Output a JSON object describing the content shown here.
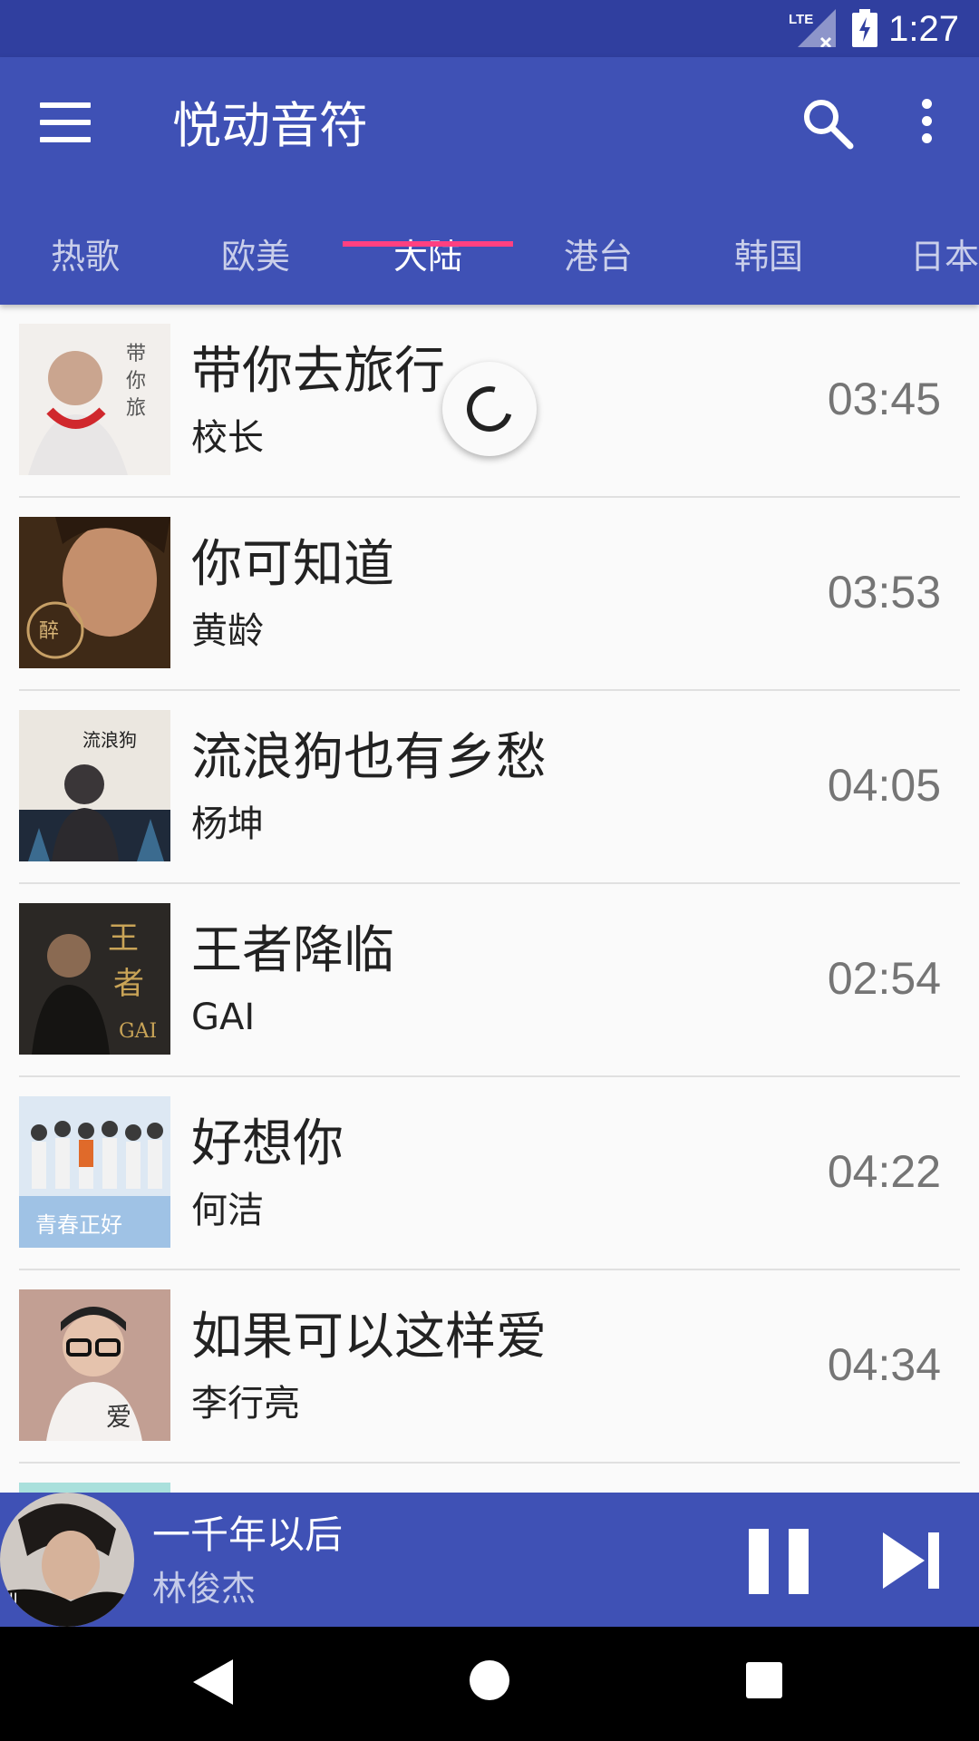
{
  "status_bar": {
    "time": "1:27",
    "network_label": "LTE",
    "icons": [
      "lte-signal-icon",
      "battery-charging-icon"
    ]
  },
  "app_bar": {
    "title": "悦动音符",
    "icons": [
      "menu-icon",
      "search-icon",
      "more-vert-icon"
    ],
    "accent_color": "#3f51b5",
    "status_color": "#303f9f",
    "indicator_color": "#ff4081"
  },
  "tabs": [
    {
      "label": "热歌",
      "active": false
    },
    {
      "label": "欧美",
      "active": false
    },
    {
      "label": "大陆",
      "active": true
    },
    {
      "label": "港台",
      "active": false
    },
    {
      "label": "韩国",
      "active": false
    },
    {
      "label": "日本",
      "active": false
    }
  ],
  "songs": [
    {
      "title": "带你去旅行",
      "artist": "校长",
      "duration": "03:45",
      "cover_colors": [
        "#f4f1ee",
        "#c9c2bd"
      ]
    },
    {
      "title": "你可知道",
      "artist": "黄龄",
      "duration": "03:53",
      "cover_colors": [
        "#5a3a1e",
        "#c7916a"
      ]
    },
    {
      "title": "流浪狗也有乡愁",
      "artist": "杨坤",
      "duration": "04:05",
      "cover_colors": [
        "#e9e4dc",
        "#3c3b3f"
      ]
    },
    {
      "title": "王者降临",
      "artist": "GAI",
      "duration": "02:54",
      "cover_colors": [
        "#2f2b27",
        "#b79a5c"
      ]
    },
    {
      "title": "好想你",
      "artist": "何洁",
      "duration": "04:22",
      "cover_colors": [
        "#dfe9f3",
        "#7aa3d6"
      ]
    },
    {
      "title": "如果可以这样爱",
      "artist": "李行亮",
      "duration": "04:34",
      "cover_colors": [
        "#8d5a4a",
        "#e7d9d2"
      ]
    }
  ],
  "now_playing": {
    "title": "一千年以后",
    "artist": "林俊杰",
    "icons": [
      "pause-icon",
      "skip-next-icon"
    ]
  },
  "nav_bar": {
    "icons": [
      "back-icon",
      "home-icon",
      "recents-icon"
    ]
  }
}
